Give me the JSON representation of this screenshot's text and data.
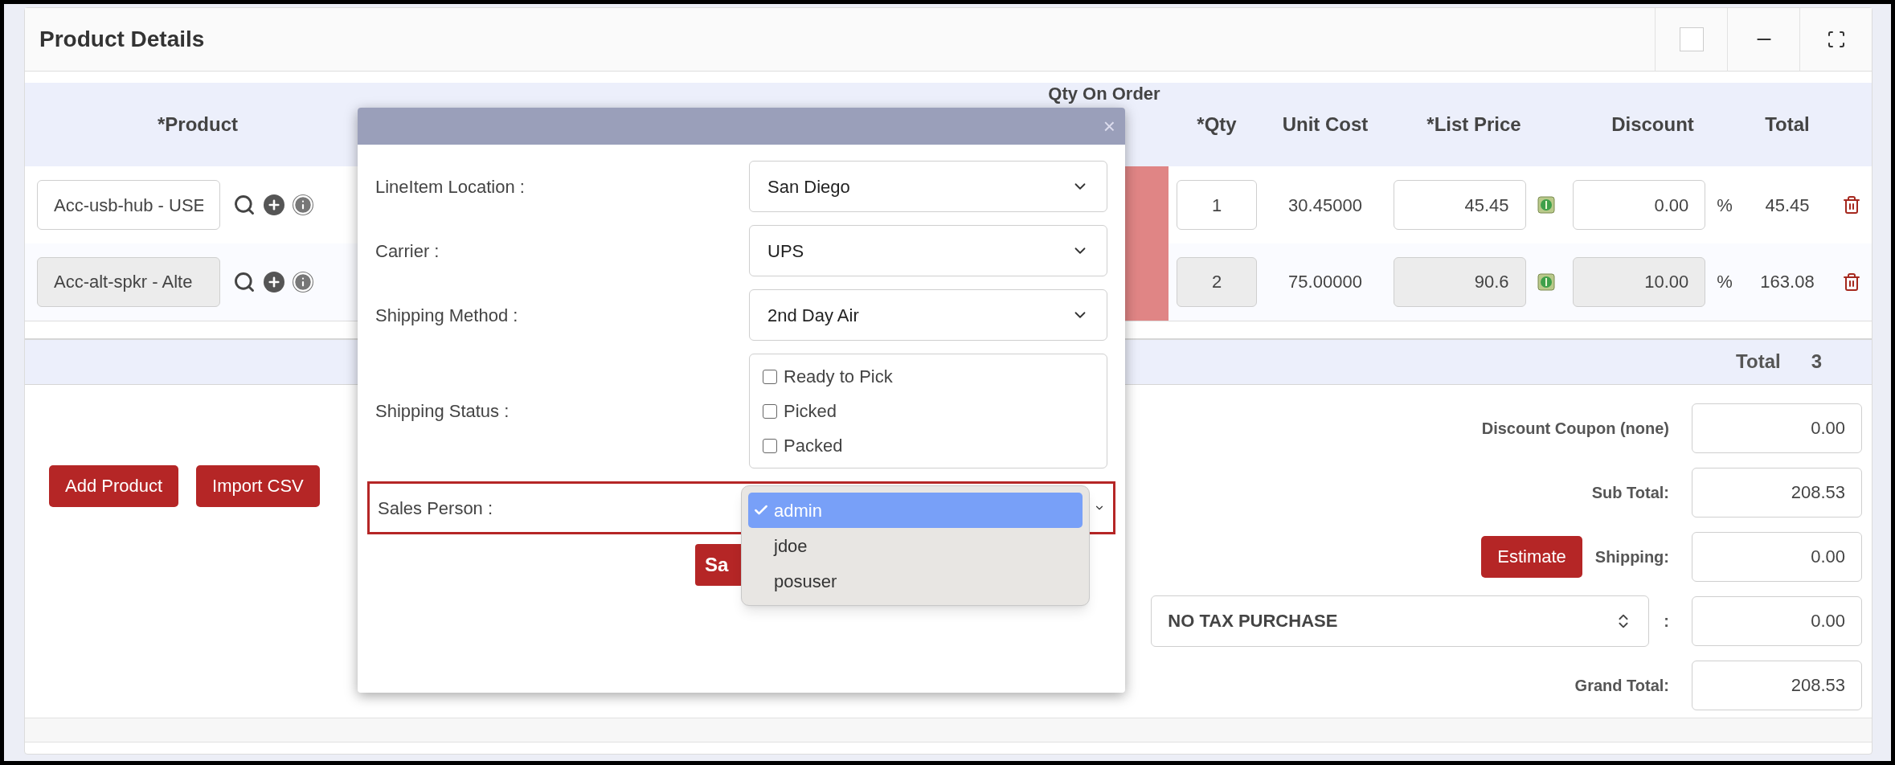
{
  "panel": {
    "title": "Product Details",
    "checked": false
  },
  "table": {
    "columns": [
      "*Product",
      "Qty On Order",
      "*Qty",
      "Unit Cost",
      "*List Price",
      "Discount",
      "Total"
    ],
    "rows": [
      {
        "product": "Acc-usb-hub - USE",
        "disabled": false,
        "qty": "1",
        "unit_cost": "30.45000",
        "list_price": "45.45",
        "discount": "0.00",
        "discount_unit": "%",
        "total": "45.45"
      },
      {
        "product": "Acc-alt-spkr - Alte",
        "disabled": true,
        "qty": "2",
        "unit_cost": "75.00000",
        "list_price": "90.6",
        "discount": "10.00",
        "discount_unit": "%",
        "total": "163.08"
      }
    ]
  },
  "total_row": {
    "label": "Total",
    "value": "3"
  },
  "actions": [
    "Add Product",
    "Import CSV"
  ],
  "summary": [
    {
      "kind": "field",
      "label": "Discount Coupon (none)",
      "value": "0.00"
    },
    {
      "kind": "field",
      "label": "Sub Total:",
      "value": "208.53"
    },
    {
      "kind": "estimate",
      "button": "Estimate",
      "label": "Shipping:",
      "value": "0.00"
    },
    {
      "kind": "tax",
      "select": "NO TAX PURCHASE",
      "label": ":",
      "value": "0.00"
    },
    {
      "kind": "field",
      "label": "Grand Total:",
      "value": "208.53"
    }
  ],
  "dialog": {
    "close": "×",
    "fields": [
      {
        "kind": "select",
        "label": "LineItem Location :",
        "value": "San Diego"
      },
      {
        "kind": "select",
        "label": "Carrier :",
        "value": "UPS"
      },
      {
        "kind": "select",
        "label": "Shipping Method :",
        "value": "2nd Day Air"
      },
      {
        "kind": "checks",
        "label": "Shipping Status :",
        "options": [
          {
            "label": "Ready to Pick",
            "checked": false
          },
          {
            "label": "Picked",
            "checked": false
          },
          {
            "label": "Packed",
            "checked": false
          }
        ]
      },
      {
        "kind": "dropdown",
        "label": "Sales Person :",
        "highlighted": true,
        "options": [
          {
            "label": "admin",
            "selected": true
          },
          {
            "label": "jdoe",
            "selected": false
          },
          {
            "label": "posuser",
            "selected": false
          }
        ]
      }
    ],
    "save_button": "Sa"
  }
}
